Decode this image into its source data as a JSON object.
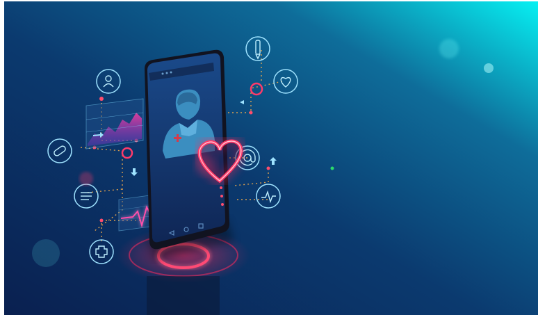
{
  "scene": {
    "subject": "smartphone-telemedicine-illustration",
    "colors": {
      "bg_dark": "#0b2a5a",
      "bg_mid": "#0f5f8e",
      "bg_light": "#08e6ef",
      "neon_red": "#ff2a5c",
      "neon_pink": "#ff5aa8",
      "line_cyan": "#9fe3ff",
      "dot_orange": "#ffb14a",
      "phone_body": "#1a1d2b",
      "screen": "#1b3f7c",
      "doctor": "#3b8ec0"
    },
    "icons": [
      "user-circle-icon",
      "pencil-icon",
      "heart-circle-icon",
      "pill-icon",
      "at-sign-icon",
      "document-list-icon",
      "pulse-circle-icon",
      "medical-cross-icon"
    ]
  }
}
